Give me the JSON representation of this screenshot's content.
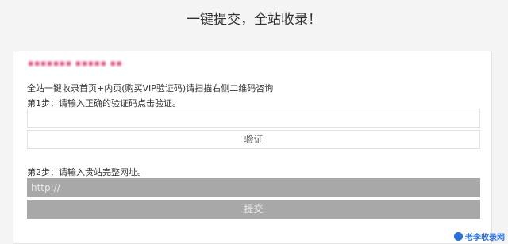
{
  "page": {
    "title": "一键提交，全站收录！"
  },
  "form": {
    "notice": "▪▪▪▪▪▪▪ ▪▪▪▪▪ ▪▪",
    "description": "全站一键收录首页+内页(购买VIP验证码)请扫描右侧二维码咨询",
    "step1_label": "第1步：请输入正确的验证码点击验证。",
    "code_input_value": "",
    "verify_label": "验证",
    "step2_label": "第2步：请输入贵站完整网址。",
    "url_placeholder": "http://",
    "submit_label": "提交"
  },
  "watermark": {
    "text": "老李收录网"
  }
}
